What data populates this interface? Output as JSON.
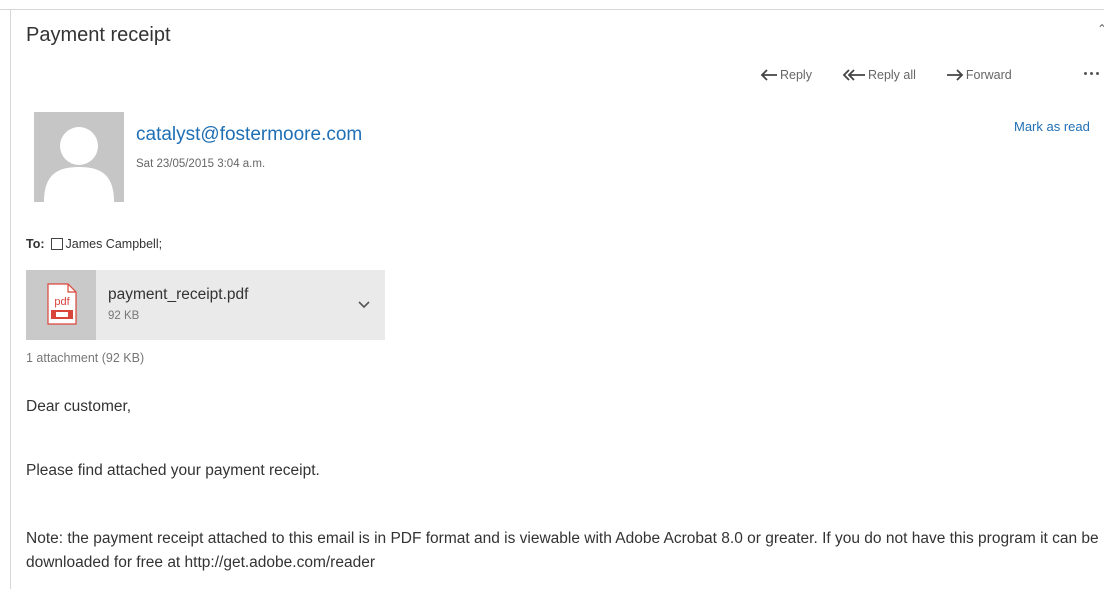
{
  "message": {
    "subject": "Payment receipt",
    "corner_glyph": "⌃"
  },
  "actions": {
    "reply": "Reply",
    "reply_all": "Reply all",
    "forward": "Forward"
  },
  "header": {
    "sender": "catalyst@fostermoore.com",
    "date": "Sat 23/05/2015 3:04 a.m.",
    "mark_as_read": "Mark as read"
  },
  "recipients": {
    "label": "To:",
    "to": "James Campbell;"
  },
  "attachment": {
    "name": "payment_receipt.pdf",
    "size": "92 KB",
    "icon_label": "pdf",
    "summary": "1 attachment (92 KB)"
  },
  "body": {
    "greeting": "Dear customer,",
    "paragraph1": "Please find attached your payment receipt.",
    "paragraph2": "Note: the payment receipt attached to this email is in PDF format and is viewable with Adobe Acrobat 8.0 or greater. If you do not have this program it can be downloaded for free at http://get.adobe.com/reader"
  },
  "colors": {
    "link": "#1f6fb5",
    "text": "#333333",
    "muted": "#777777",
    "pdf_red": "#d9453a"
  }
}
